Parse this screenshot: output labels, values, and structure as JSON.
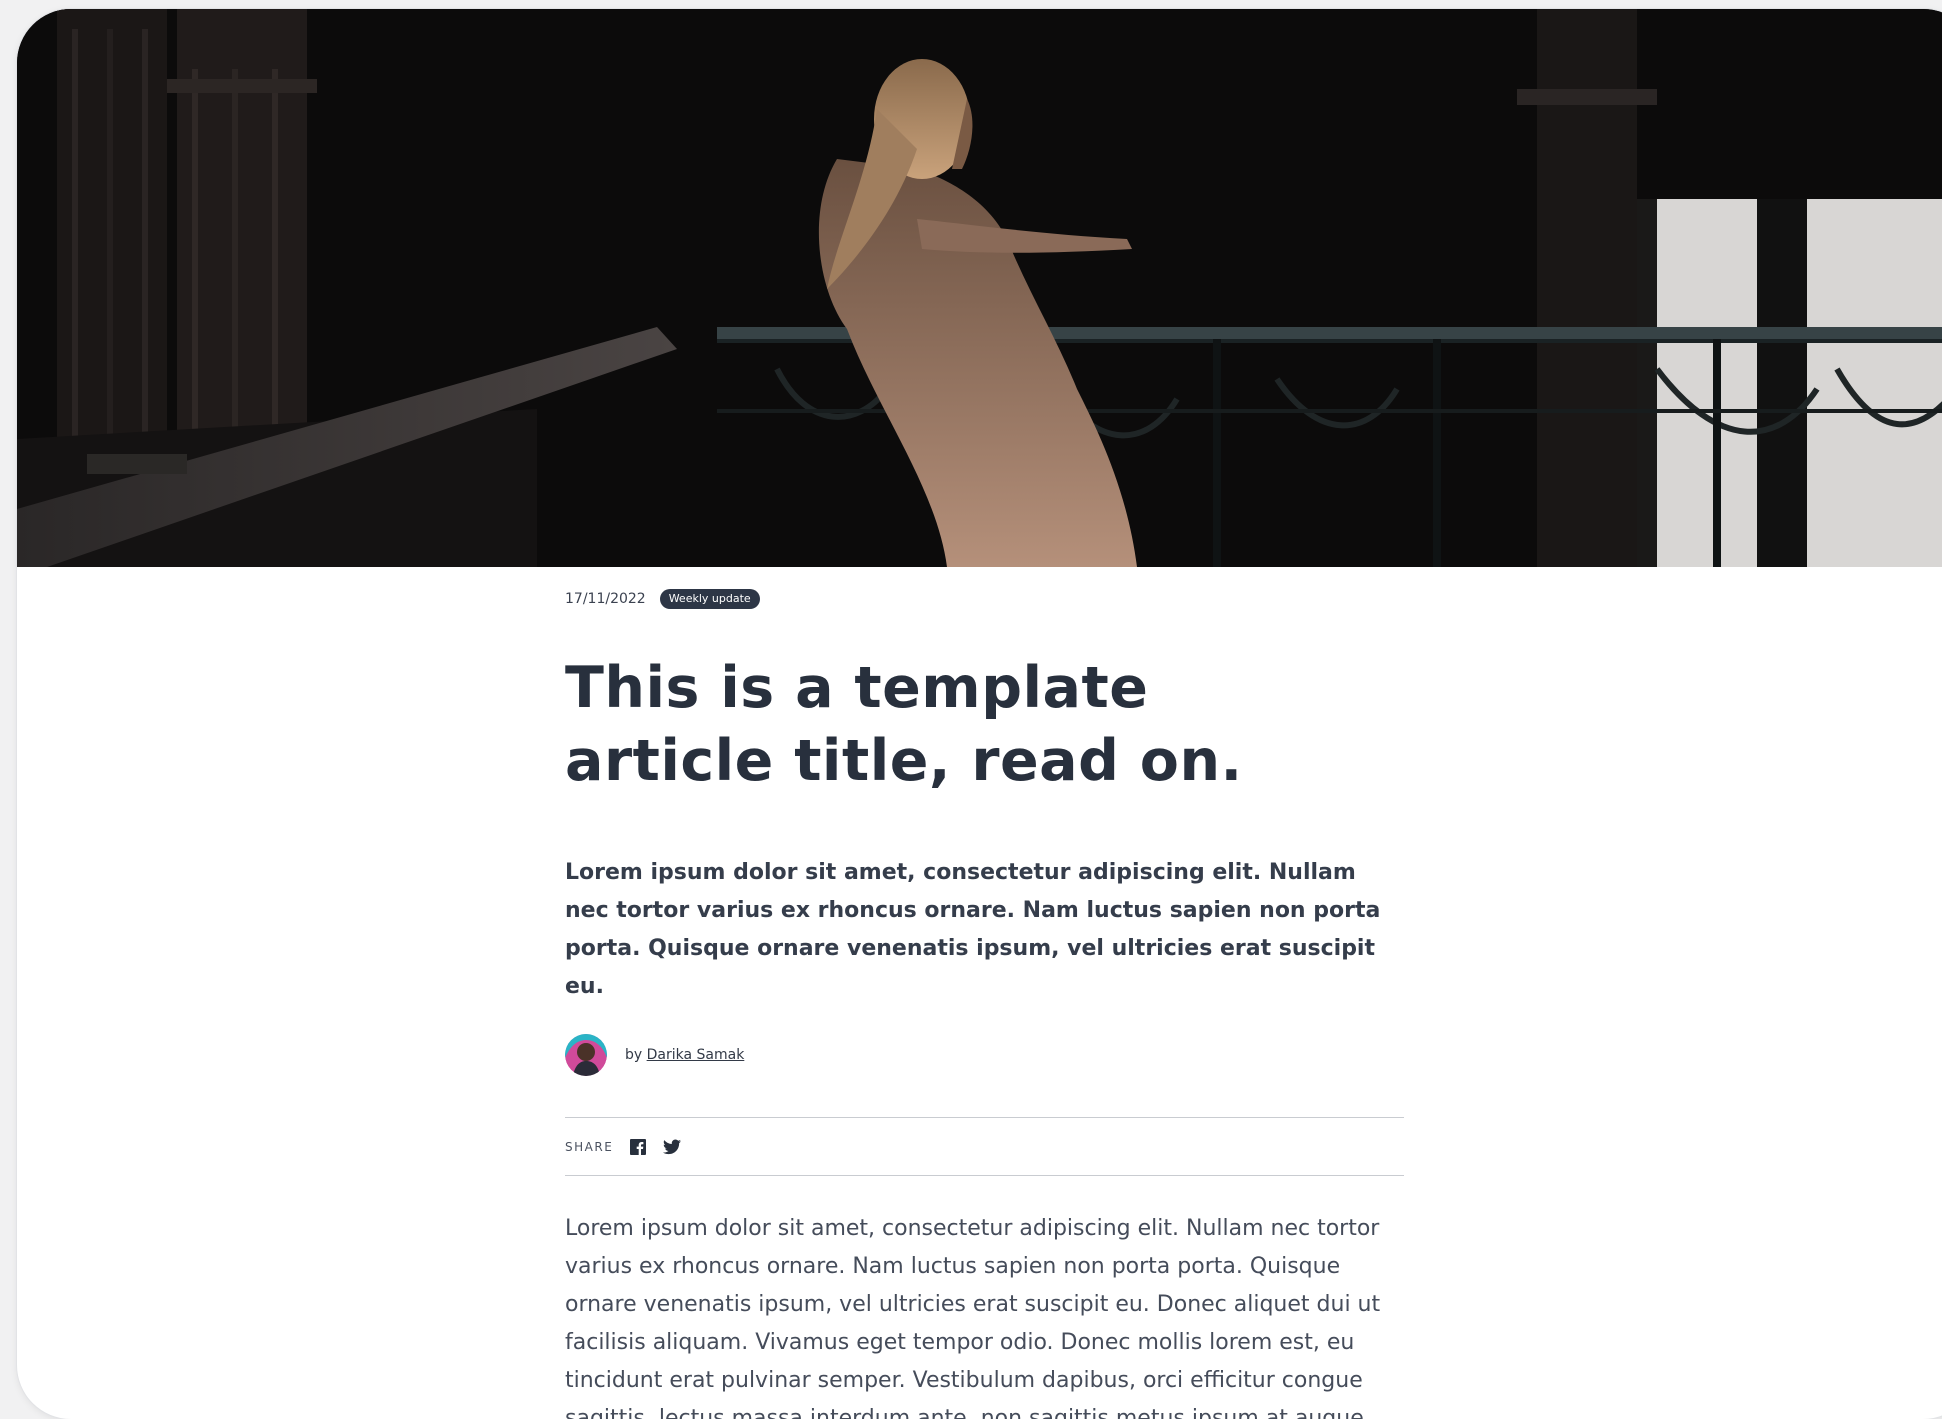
{
  "hero": {
    "image": "woman-on-balcony-photo"
  },
  "article": {
    "date": "17/11/2022",
    "category": "Weekly update",
    "title": "This is a template article title, read on.",
    "lead": "Lorem ipsum dolor sit amet, consectetur adipiscing elit. Nullam nec tortor varius ex rhoncus ornare. Nam luctus sapien non porta porta. Quisque ornare venenatis ipsum, vel ultricies erat suscipit eu.",
    "author": {
      "by_label": "by",
      "name": "Darika Samak"
    },
    "share": {
      "label": "SHARE",
      "icons": [
        "facebook-icon",
        "twitter-icon"
      ]
    },
    "body": "Lorem ipsum dolor sit amet, consectetur adipiscing elit. Nullam nec tortor varius ex rhoncus ornare. Nam luctus sapien non porta porta. Quisque ornare venenatis ipsum, vel ultricies erat suscipit eu. Donec aliquet dui ut facilisis aliquam. Vivamus eget tempor odio. Donec mollis lorem est, eu tincidunt erat pulvinar semper. Vestibulum dapibus, orci efficitur congue sagittis, lectus massa interdum ante, non sagittis metus ipsum at augue. Aenean vestibulum"
  },
  "colors": {
    "text": "#28303d",
    "badge": "#2d3646",
    "divider": "#c9ccd1"
  }
}
